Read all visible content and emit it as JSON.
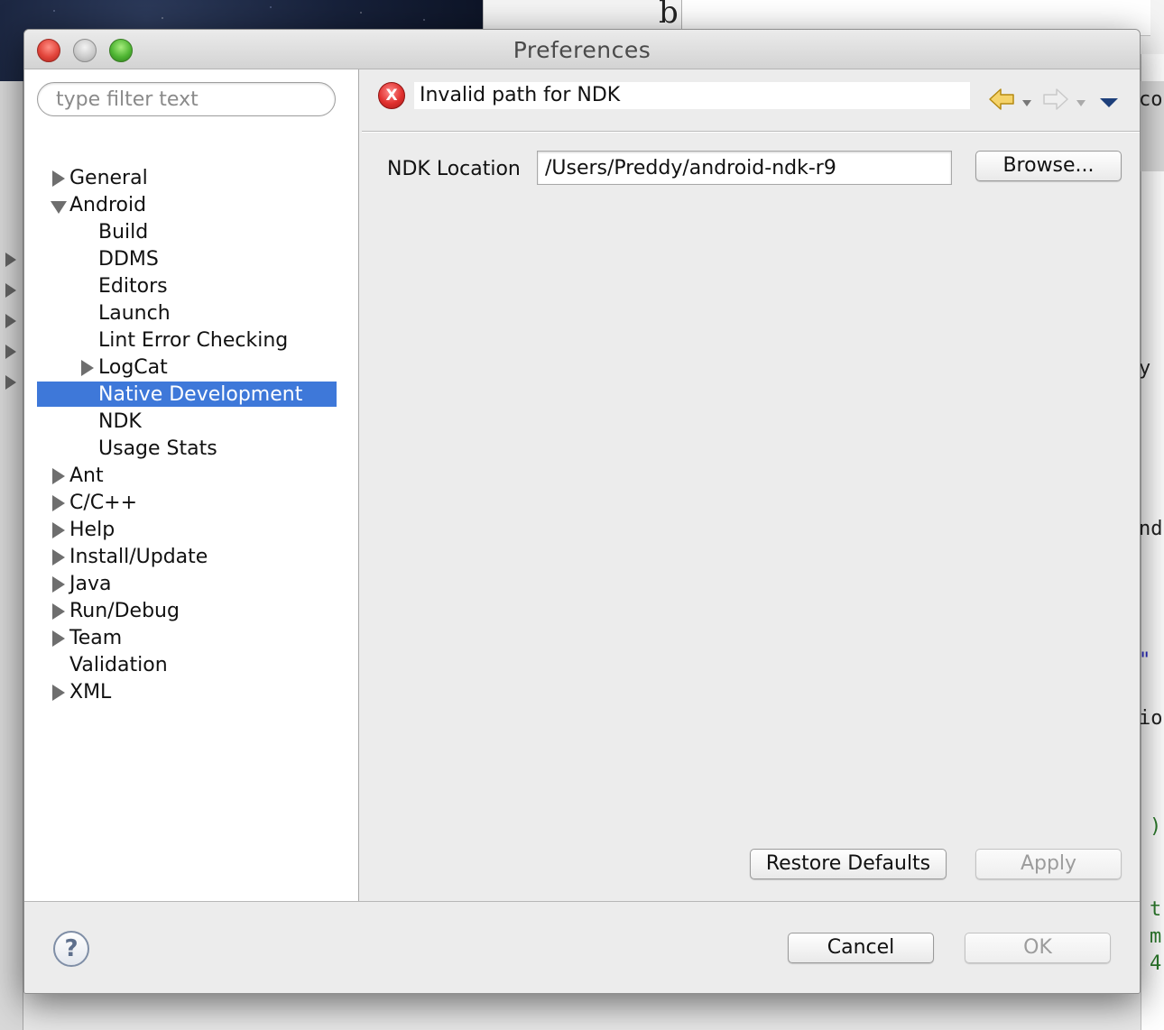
{
  "window": {
    "title": "Preferences"
  },
  "filter": {
    "placeholder": "type filter text"
  },
  "tree": [
    {
      "label": "General",
      "level": 0,
      "twisty": "closed"
    },
    {
      "label": "Android",
      "level": 0,
      "twisty": "open"
    },
    {
      "label": "Build",
      "level": 1,
      "twisty": "none"
    },
    {
      "label": "DDMS",
      "level": 1,
      "twisty": "none"
    },
    {
      "label": "Editors",
      "level": 1,
      "twisty": "none"
    },
    {
      "label": "Launch",
      "level": 1,
      "twisty": "none"
    },
    {
      "label": "Lint Error Checking",
      "level": 1,
      "twisty": "none"
    },
    {
      "label": "LogCat",
      "level": 1,
      "twisty": "closed"
    },
    {
      "label": "Native Development",
      "level": 1,
      "twisty": "none",
      "selected": true
    },
    {
      "label": "NDK",
      "level": 1,
      "twisty": "none"
    },
    {
      "label": "Usage Stats",
      "level": 1,
      "twisty": "none"
    },
    {
      "label": "Ant",
      "level": 0,
      "twisty": "closed"
    },
    {
      "label": "C/C++",
      "level": 0,
      "twisty": "closed"
    },
    {
      "label": "Help",
      "level": 0,
      "twisty": "closed"
    },
    {
      "label": "Install/Update",
      "level": 0,
      "twisty": "closed"
    },
    {
      "label": "Java",
      "level": 0,
      "twisty": "closed"
    },
    {
      "label": "Run/Debug",
      "level": 0,
      "twisty": "closed"
    },
    {
      "label": "Team",
      "level": 0,
      "twisty": "closed"
    },
    {
      "label": "Validation",
      "level": 0,
      "twisty": "none"
    },
    {
      "label": "XML",
      "level": 0,
      "twisty": "closed"
    }
  ],
  "message": {
    "icon": "error-icon",
    "icon_glyph": "X",
    "text": "Invalid path for NDK"
  },
  "nav": {
    "back_icon": "back-arrow-icon",
    "forward_icon": "forward-arrow-icon",
    "menu_icon": "view-menu-icon"
  },
  "ndk": {
    "label": "NDK Location",
    "value": "/Users/Preddy/android-ndk-r9"
  },
  "buttons": {
    "browse": "Browse...",
    "restore_defaults": "Restore Defaults",
    "apply": "Apply",
    "cancel": "Cancel",
    "ok": "OK",
    "help": "?"
  },
  "background": {
    "doc_fragment": "b",
    "code_fragments": [
      "co",
      "y",
      "nd",
      "\"",
      "io",
      ")",
      "t",
      "m",
      "4"
    ]
  },
  "colors": {
    "selection": "#3e78d9",
    "error": "#e0302e",
    "close": "#e2453b",
    "zoom": "#4fb533"
  }
}
